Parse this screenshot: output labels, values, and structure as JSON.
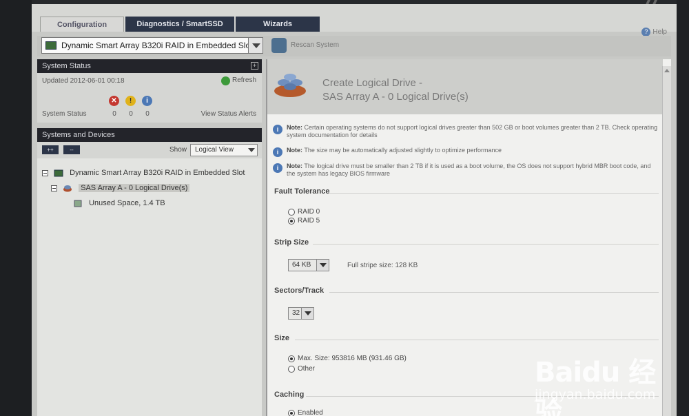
{
  "tabs": [
    {
      "label": "Configuration",
      "active": true
    },
    {
      "label": "Diagnostics / SmartSSD",
      "active": false
    },
    {
      "label": "Wizards",
      "active": false
    }
  ],
  "help_label": "Help",
  "controller_select": {
    "value": "Dynamic Smart Array B320i RAID in Embedded Slot"
  },
  "rescan_label": "Rescan System",
  "system_status": {
    "title": "System Status",
    "updated": "Updated 2012-06-01 00:18",
    "refresh_label": "Refresh",
    "status_label": "System Status",
    "counts": {
      "error": "0",
      "warning": "0",
      "info": "0"
    },
    "view_alerts_label": "View Status Alerts"
  },
  "systems_devices": {
    "title": "Systems and Devices",
    "expand_label": "++",
    "collapse_label": "--",
    "show_label": "Show",
    "view_select": "Logical View",
    "tree": [
      {
        "label": "Dynamic Smart Array B320i RAID in Embedded Slot"
      },
      {
        "label": "SAS Array A - 0 Logical Drive(s)"
      },
      {
        "label": "Unused Space, 1.4 TB"
      }
    ]
  },
  "main": {
    "title_line1": "Create Logical Drive -",
    "title_line2": "SAS Array A - 0 Logical Drive(s)",
    "notes": [
      {
        "prefix": "Note:",
        "text": "Certain operating systems do not support logical drives greater than 502 GB or boot volumes greater than 2 TB. Check operating system documentation for details"
      },
      {
        "prefix": "Note:",
        "text": "The size may be automatically adjusted slightly to optimize performance"
      },
      {
        "prefix": "Note:",
        "text": "The logical drive must be smaller than 2 TB if it is used as a boot volume, the OS does not support hybrid MBR boot code, and the system has legacy BIOS firmware"
      }
    ],
    "fault_tolerance": {
      "label": "Fault Tolerance",
      "options": [
        "RAID 0",
        "RAID 5"
      ],
      "selected": "RAID 5"
    },
    "strip_size": {
      "label": "Strip Size",
      "value": "64 KB",
      "full_stripe": "Full stripe size: 128 KB"
    },
    "sectors_track": {
      "label": "Sectors/Track",
      "value": "32"
    },
    "size": {
      "label": "Size",
      "options": [
        "Max. Size: 953816 MB (931.46 GB)",
        "Other"
      ],
      "selected": "Max. Size: 953816 MB (931.46 GB)"
    },
    "caching": {
      "label": "Caching",
      "option": "Enabled"
    }
  },
  "watermark": {
    "brand": "Baidu 经验",
    "url": "jingyan.baidu.com"
  }
}
